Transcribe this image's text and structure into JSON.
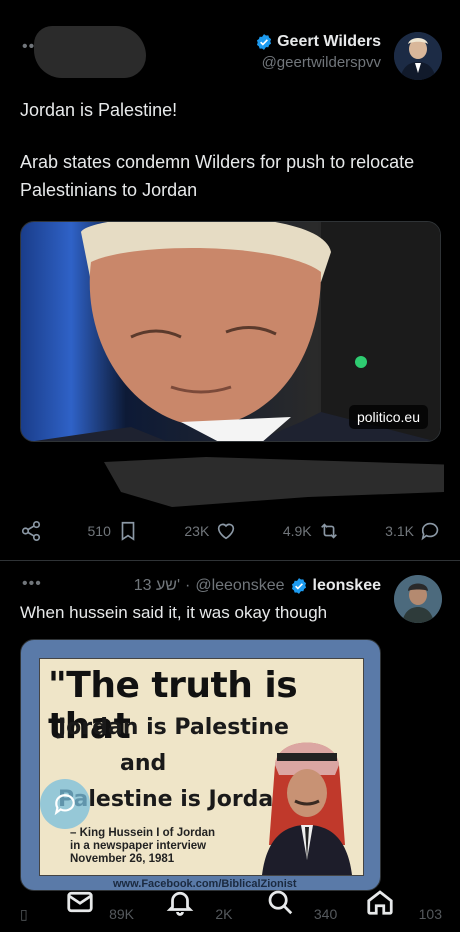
{
  "post1": {
    "author_name": "Geert Wilders",
    "author_handle": "@geertwilderspvv",
    "text_line1": "Jordan is Palestine!",
    "text_line2": "Arab states condemn Wilders for push to relocate Palestinians to Jordan",
    "link_domain": "politico.eu",
    "stats": {
      "bookmarks": "510",
      "likes": "23K",
      "reposts": "4.9K",
      "replies": "3.1K"
    }
  },
  "post2": {
    "time": "13 שע'",
    "handle": "@leeonskee",
    "name": "leonskee",
    "text": "When hussein said it, it was okay though",
    "poster": {
      "quote": "\"The truth is that",
      "line1": "Jordan is Palestine",
      "line2": "and",
      "line3": "Palestine is Jordan\"",
      "attrib1": "– King Hussein I of Jordan",
      "attrib2": "in a newspaper interview",
      "attrib3": "November 26, 1981",
      "url": "www.Facebook.com/BiblicalZionist"
    },
    "stats": {
      "views": "89K",
      "likes": "2K",
      "reposts": "340",
      "replies": "103"
    }
  },
  "colors": {
    "background": "#000000",
    "verified_blue": "#1d9bf0",
    "muted": "#71767b"
  },
  "icons": {
    "more": "more-icon",
    "verified": "verified-badge-icon",
    "share": "share-icon",
    "bookmark": "bookmark-icon",
    "like": "heart-icon",
    "repost": "repost-icon",
    "reply": "reply-icon",
    "mail": "mail-icon",
    "notifications": "bell-icon",
    "search": "search-icon",
    "home": "home-icon"
  }
}
